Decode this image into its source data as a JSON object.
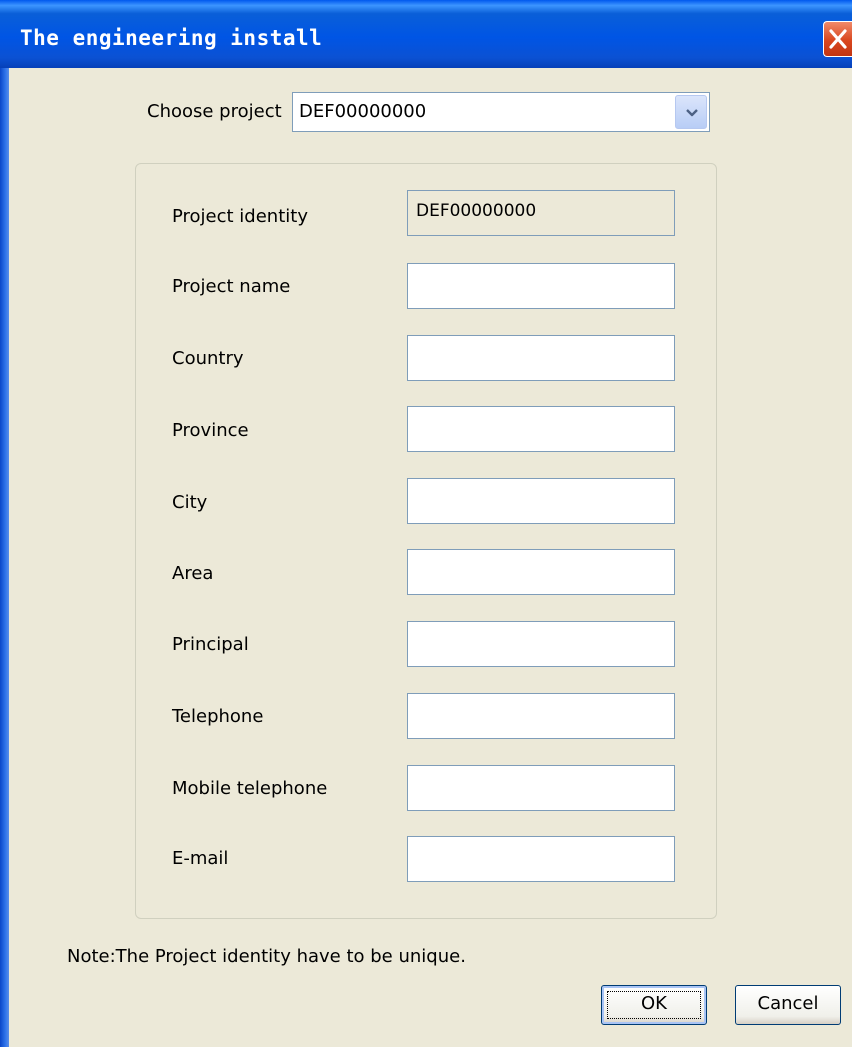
{
  "window": {
    "title": "The engineering install"
  },
  "choose_project": {
    "label": "Choose project",
    "selected": "DEF00000000"
  },
  "fields": [
    {
      "label": "Project identity",
      "value": "DEF00000000",
      "readonly": true
    },
    {
      "label": "Project name",
      "value": ""
    },
    {
      "label": "Country",
      "value": ""
    },
    {
      "label": "Province",
      "value": ""
    },
    {
      "label": "City",
      "value": ""
    },
    {
      "label": "Area",
      "value": ""
    },
    {
      "label": "Principal",
      "value": ""
    },
    {
      "label": "Telephone",
      "value": ""
    },
    {
      "label": "Mobile telephone",
      "value": ""
    },
    {
      "label": "E-mail",
      "value": ""
    }
  ],
  "note": "Note:The Project identity have to be unique.",
  "buttons": {
    "ok": "OK",
    "cancel": "Cancel"
  },
  "icons": {
    "close": "close-icon",
    "dropdown": "chevron-down-icon"
  },
  "colors": {
    "titlebar": "#0055e5",
    "close_button": "#d9461e",
    "dialog_background": "#ece9d8"
  }
}
